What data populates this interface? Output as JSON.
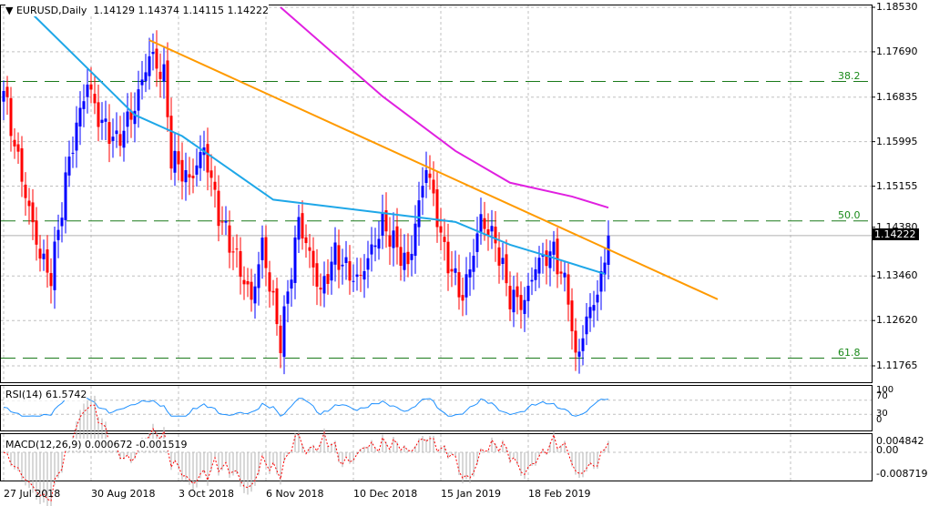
{
  "header": {
    "symbol": "EURUSD,Daily",
    "open": "1.14129",
    "high": "1.14374",
    "low": "1.14115",
    "close": "1.14222"
  },
  "price_tag": "1.14222",
  "rsi": {
    "label": "RSI(14) 61.5742",
    "levels": [
      "100",
      "70",
      "30",
      "0"
    ]
  },
  "macd": {
    "label": "MACD(12,26,9) 0.000672 -0.001519",
    "levels": [
      "0.004842",
      "0.00",
      "-0.008719"
    ]
  },
  "colors": {
    "up": "#0000ff",
    "down": "#ff0000",
    "sma100": "#1ea7e8",
    "sma200": "#e020e0",
    "trend": "#ff9a00",
    "fib": "#1a7a1a"
  },
  "chart_data": {
    "type": "candlestick",
    "title": "EURUSD,Daily",
    "ylim": [
      1.114,
      1.1885
    ],
    "y_ticks": [
      "1.18530",
      "1.17690",
      "1.16835",
      "1.15995",
      "1.15155",
      "1.14380",
      "1.13460",
      "1.12620",
      "1.11765"
    ],
    "x_ticks": [
      "27 Jul 2018",
      "30 Aug 2018",
      "3 Oct 2018",
      "6 Nov 2018",
      "10 Dec 2018",
      "15 Jan 2019",
      "18 Feb 2019"
    ],
    "close_keypoints": [
      [
        0,
        1.1695
      ],
      [
        4,
        1.1575
      ],
      [
        10,
        1.14
      ],
      [
        13,
        1.1352
      ],
      [
        18,
        1.1558
      ],
      [
        23,
        1.1695
      ],
      [
        26,
        1.163
      ],
      [
        31,
        1.16
      ],
      [
        36,
        1.168
      ],
      [
        40,
        1.178
      ],
      [
        44,
        1.173
      ],
      [
        46,
        1.157
      ],
      [
        51,
        1.151
      ],
      [
        55,
        1.157
      ],
      [
        59,
        1.1455
      ],
      [
        64,
        1.1386
      ],
      [
        68,
        1.1317
      ],
      [
        71,
        1.142
      ],
      [
        76,
        1.1223
      ],
      [
        81,
        1.1437
      ],
      [
        87,
        1.13
      ],
      [
        91,
        1.1386
      ],
      [
        97,
        1.135
      ],
      [
        104,
        1.1455
      ],
      [
        111,
        1.135
      ],
      [
        116,
        1.154
      ],
      [
        121,
        1.1386
      ],
      [
        126,
        1.1317
      ],
      [
        131,
        1.147
      ],
      [
        135,
        1.142
      ],
      [
        139,
        1.13
      ],
      [
        143,
        1.128
      ],
      [
        146,
        1.135
      ],
      [
        151,
        1.1386
      ],
      [
        155,
        1.1317
      ],
      [
        157,
        1.1197
      ],
      [
        160,
        1.128
      ],
      [
        164,
        1.135
      ],
      [
        166,
        1.1422
      ]
    ],
    "sma100": [
      [
        6,
        1.1853
      ],
      [
        36,
        1.165
      ],
      [
        49,
        1.161
      ],
      [
        74,
        1.149
      ],
      [
        104,
        1.1465
      ],
      [
        124,
        1.1448
      ],
      [
        139,
        1.1405
      ],
      [
        151,
        1.138
      ],
      [
        165,
        1.135
      ]
    ],
    "sma200": [
      [
        76,
        1.1853
      ],
      [
        104,
        1.1685
      ],
      [
        124,
        1.1582
      ],
      [
        139,
        1.1522
      ],
      [
        156,
        1.1496
      ],
      [
        166,
        1.1475
      ]
    ],
    "trendline": [
      [
        40,
        1.1791
      ],
      [
        196,
        1.1302
      ]
    ],
    "fib_levels": [
      {
        "label": "38.2",
        "price": 1.1713
      },
      {
        "label": "50.0",
        "price": 1.145
      },
      {
        "label": "61.8",
        "price": 1.1191
      }
    ],
    "rsi_last": 61.5742
  }
}
